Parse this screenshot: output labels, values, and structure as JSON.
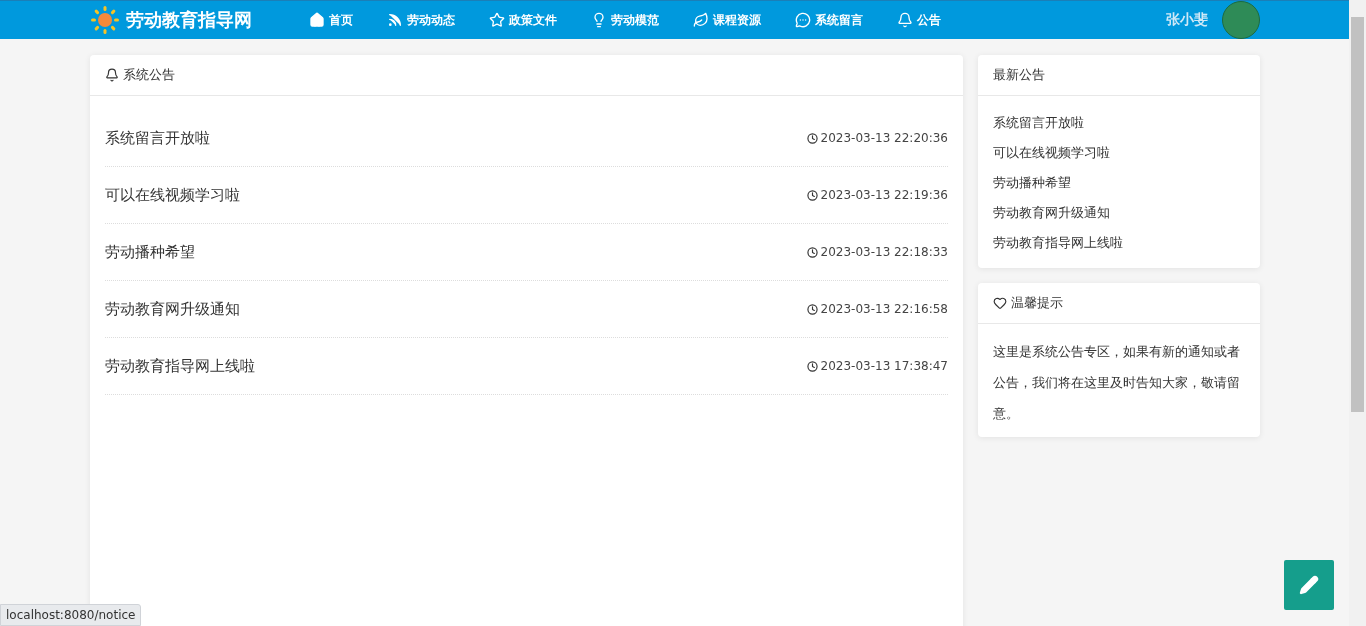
{
  "nav": {
    "logo": "劳动教育指导网",
    "items": [
      {
        "kind": "home",
        "label": "首页"
      },
      {
        "kind": "rss",
        "label": "劳动动态"
      },
      {
        "kind": "star",
        "label": "政策文件"
      },
      {
        "kind": "bulb",
        "label": "劳动模范"
      },
      {
        "kind": "leaf",
        "label": "课程资源"
      },
      {
        "kind": "chat",
        "label": "系统留言"
      },
      {
        "kind": "bell",
        "label": "公告"
      }
    ],
    "user": "张小斐"
  },
  "notices": {
    "title": "系统公告",
    "rows": [
      {
        "title": "系统留言开放啦",
        "time": "2023-03-13 22:20:36"
      },
      {
        "title": "可以在线视频学习啦",
        "time": "2023-03-13 22:19:36"
      },
      {
        "title": "劳动播种希望",
        "time": "2023-03-13 22:18:33"
      },
      {
        "title": "劳动教育网升级通知",
        "time": "2023-03-13 22:16:58"
      },
      {
        "title": "劳动教育指导网上线啦",
        "time": "2023-03-13 17:38:47"
      }
    ]
  },
  "latest": {
    "title": "最新公告",
    "items": [
      "系统留言开放啦",
      "可以在线视频学习啦",
      "劳动播种希望",
      "劳动教育网升级通知",
      "劳动教育指导网上线啦"
    ]
  },
  "tips": {
    "title": "温馨提示",
    "text": "这里是系统公告专区，如果有新的通知或者公告，我们将在这里及时告知大家，敬请留意。"
  },
  "status_url": "localhost:8080/notice"
}
